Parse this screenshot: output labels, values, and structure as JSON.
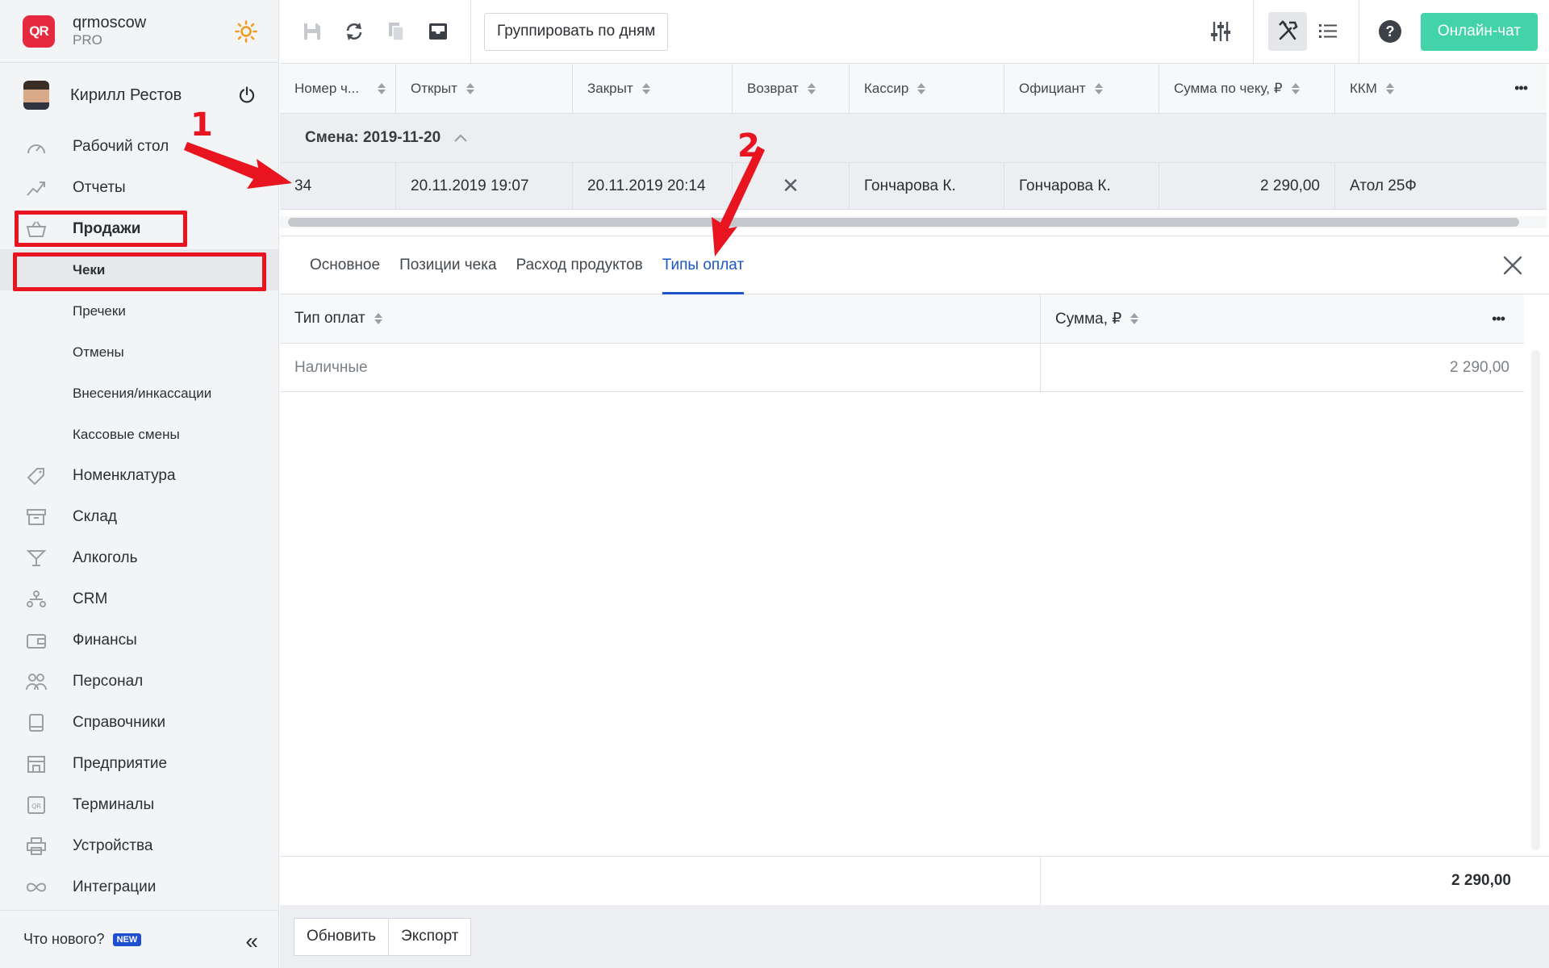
{
  "brand": {
    "name": "qrmoscow",
    "plan": "PRO",
    "logo_text": "QR",
    "accent": "#e6293e"
  },
  "user": {
    "name": "Кирилл Рестов"
  },
  "sidebar": {
    "items": [
      {
        "label": "Рабочий стол",
        "icon": "dashboard-icon"
      },
      {
        "label": "Отчеты",
        "icon": "chart-icon"
      },
      {
        "label": "Продажи",
        "icon": "basket-icon"
      },
      {
        "label": "Номенклатура",
        "icon": "tag-icon"
      },
      {
        "label": "Склад",
        "icon": "archive-icon"
      },
      {
        "label": "Алкоголь",
        "icon": "cocktail-icon"
      },
      {
        "label": "CRM",
        "icon": "hierarchy-icon"
      },
      {
        "label": "Финансы",
        "icon": "wallet-icon"
      },
      {
        "label": "Персонал",
        "icon": "people-icon"
      },
      {
        "label": "Справочники",
        "icon": "book-icon"
      },
      {
        "label": "Предприятие",
        "icon": "store-icon"
      },
      {
        "label": "Терминалы",
        "icon": "terminal-icon"
      },
      {
        "label": "Устройства",
        "icon": "printer-icon"
      },
      {
        "label": "Интеграции",
        "icon": "infinity-icon"
      }
    ],
    "sales_sub": [
      "Чеки",
      "Пречеки",
      "Отмены",
      "Внесения/инкассации",
      "Кассовые смены"
    ],
    "news_label": "Что нового?",
    "new_badge": "NEW",
    "collapse_glyph": "«"
  },
  "toolbar": {
    "group_label": "Группировать по дням",
    "chat_label": "Онлайн-чат",
    "chat_color": "#42d3a8"
  },
  "receipts": {
    "columns": [
      "Номер ч...",
      "Открыт",
      "Закрыт",
      "Возврат",
      "Кассир",
      "Официант",
      "Сумма по чеку, ₽",
      "ККМ"
    ],
    "more_glyph": "•••",
    "group_label": "Смена: 2019-11-20",
    "rows": [
      {
        "number": "34",
        "opened": "20.11.2019 19:07",
        "closed": "20.11.2019 20:14",
        "refund_glyph": "✕",
        "cashier": "Гончарова К.",
        "waiter": "Гончарова К.",
        "sum": "2 290,00",
        "kkm": "Атол 25Ф"
      }
    ]
  },
  "detail": {
    "tabs": [
      "Основное",
      "Позиции чека",
      "Расход продуктов",
      "Типы оплат"
    ],
    "active_tab": "Типы оплат",
    "active_color": "#1a56c7",
    "columns": [
      "Тип оплат",
      "Сумма, ₽"
    ],
    "rows": [
      {
        "type": "Наличные",
        "sum": "2 290,00"
      }
    ],
    "total": "2 290,00"
  },
  "footer": {
    "refresh_label": "Обновить",
    "export_label": "Экспорт"
  },
  "annotations": {
    "marker_1": "1",
    "marker_2": "2",
    "color": "#e8141f"
  }
}
